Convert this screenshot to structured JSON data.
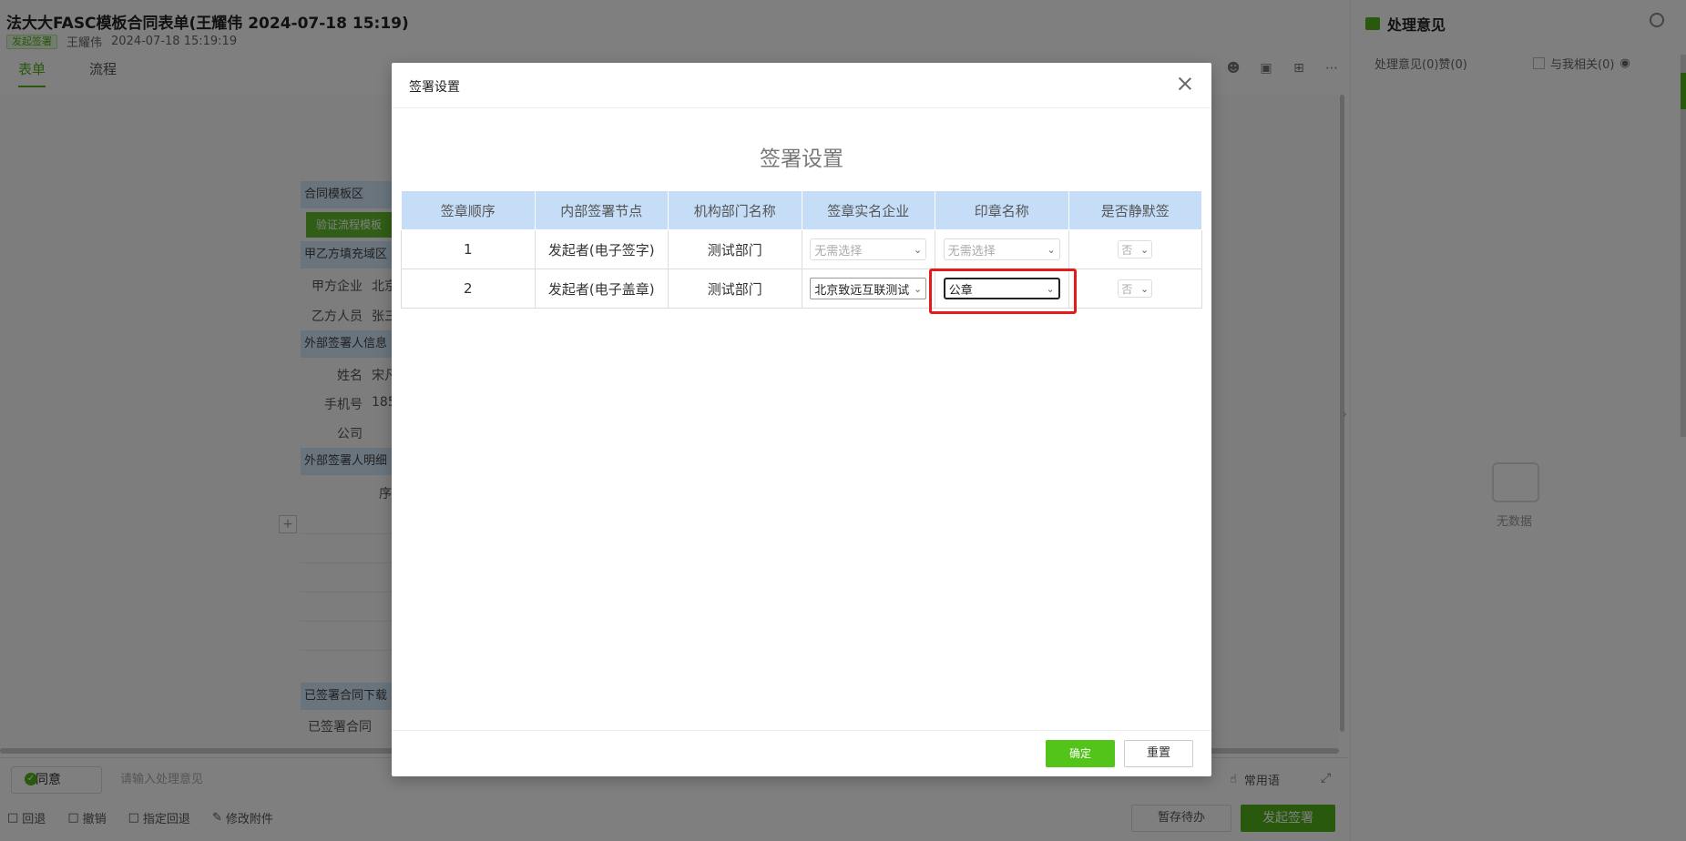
{
  "app": {
    "title": "法大大FASC模板合同表单(王耀伟 2024-07-18 15:19)",
    "status_badge": "发起签署",
    "author": "王耀伟",
    "datetime": "2024-07-18 15:19:19",
    "tabs": [
      "表单",
      "流程"
    ]
  },
  "form": {
    "sections": [
      "合同模板区",
      "甲乙方填充域区",
      "外部签署人信息",
      "外部签署人明细"
    ],
    "verify_button": "验证流程模板",
    "fields": [
      {
        "label": "甲方企业",
        "value": "北京"
      },
      {
        "label": "乙方人员",
        "value": "张三"
      },
      {
        "label": "姓名",
        "value": "宋凡"
      },
      {
        "label": "手机号",
        "value": "185"
      },
      {
        "label": "公司",
        "value": ""
      }
    ],
    "seq_header": "序",
    "signed_section": "已签署合同下载",
    "signed_label": "已签署合同"
  },
  "bottom": {
    "agree_label": "同意",
    "opinion_placeholder": "请输入处理意见",
    "common_words": "常用语",
    "actions": [
      "回退",
      "撤销",
      "指定回退",
      "修改附件"
    ],
    "save_label": "暂存待办",
    "start_label": "发起签署"
  },
  "side": {
    "title": "处理意见",
    "meta": "处理意见(0)赞(0)",
    "related": "与我相关(0)",
    "empty": "无数据"
  },
  "modal": {
    "title": "签署设置",
    "heading": "签署设置",
    "columns": [
      "签章顺序",
      "内部签署节点",
      "机构部门名称",
      "签章实名企业",
      "印章名称",
      "是否静默签"
    ],
    "rows": [
      {
        "order": "1",
        "node": "发起者(电子签字)",
        "dept": "测试部门",
        "company": "无需选择",
        "seal": "无需选择",
        "silent": "否"
      },
      {
        "order": "2",
        "node": "发起者(电子盖章)",
        "dept": "测试部门",
        "company": "北京致远互联测试",
        "seal": "公章",
        "silent": "否"
      }
    ],
    "ok_label": "确定",
    "reset_label": "重置"
  }
}
